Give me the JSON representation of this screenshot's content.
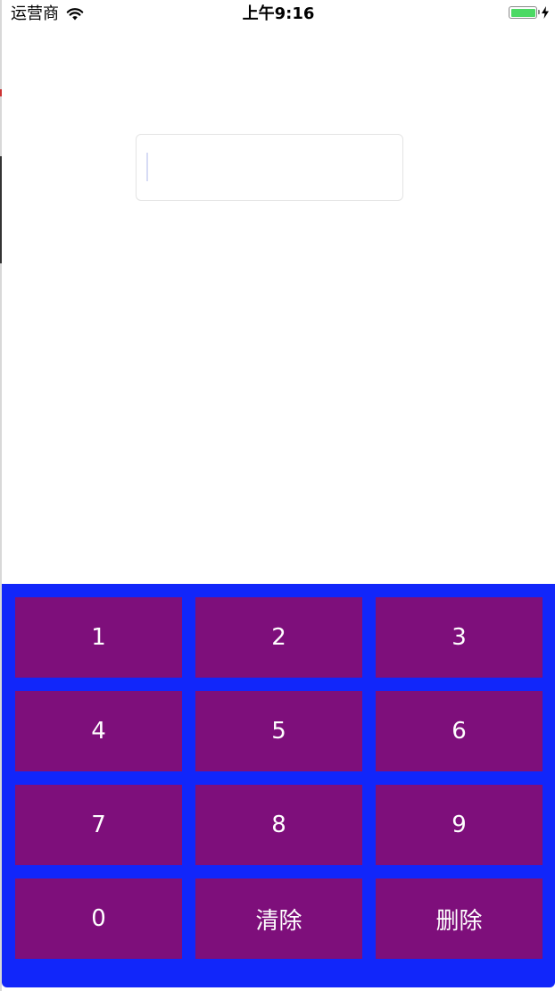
{
  "status_bar": {
    "carrier": "运营商",
    "time": "上午9:16",
    "battery_level": 1.0,
    "icons": [
      "wifi-icon",
      "battery-icon",
      "charging-bolt-icon"
    ]
  },
  "input": {
    "value": "",
    "placeholder": ""
  },
  "keypad": {
    "keys": [
      {
        "label": "1"
      },
      {
        "label": "2"
      },
      {
        "label": "3"
      },
      {
        "label": "4"
      },
      {
        "label": "5"
      },
      {
        "label": "6"
      },
      {
        "label": "7"
      },
      {
        "label": "8"
      },
      {
        "label": "9"
      },
      {
        "label": "0"
      },
      {
        "label": "清除"
      },
      {
        "label": "删除"
      }
    ]
  },
  "colors": {
    "keypad_background": "#1126fa",
    "key_background": "#7e0f7b",
    "key_text": "#ffffff",
    "battery_fill": "#4cd964"
  }
}
